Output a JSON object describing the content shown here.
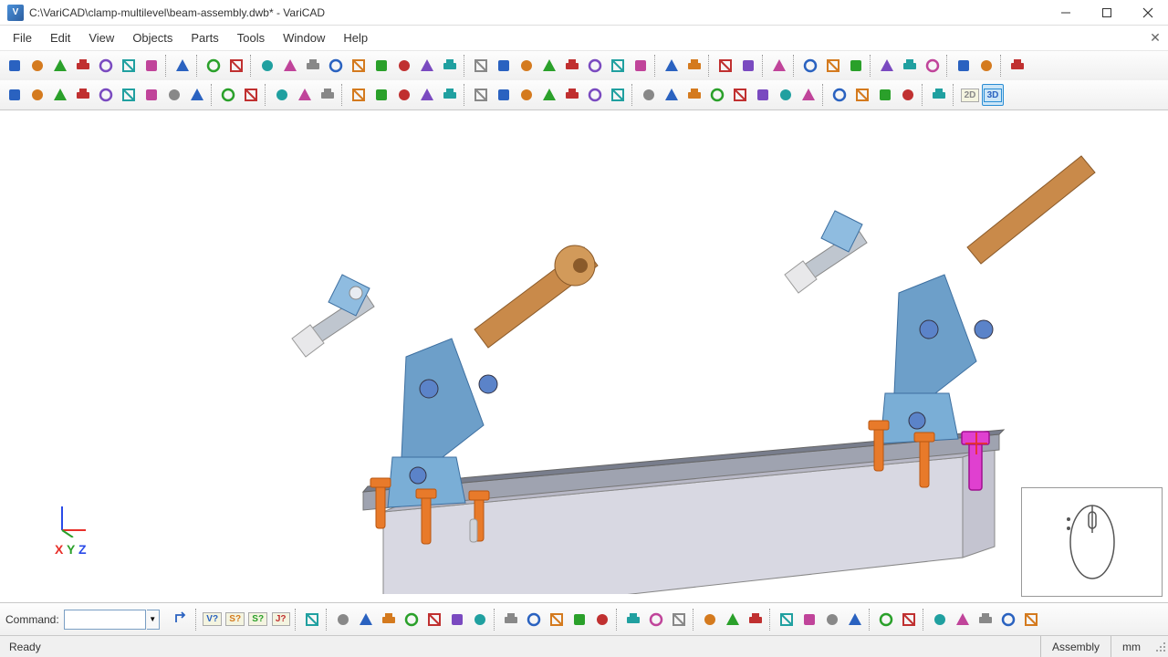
{
  "window": {
    "title": "C:\\VariCAD\\clamp-multilevel\\beam-assembly.dwb* - VariCAD",
    "app_badge": "V"
  },
  "menu": {
    "items": [
      "File",
      "Edit",
      "View",
      "Objects",
      "Parts",
      "Tools",
      "Window",
      "Help"
    ]
  },
  "toolbar1": [
    {
      "name": "new-file-icon",
      "i": true
    },
    {
      "name": "open-file-icon",
      "i": true
    },
    {
      "name": "open-folder-icon",
      "i": true
    },
    {
      "name": "export-icon",
      "i": true
    },
    {
      "name": "save-icon",
      "i": true
    },
    {
      "name": "save-all-icon",
      "i": true
    },
    {
      "name": "check-file-icon",
      "i": true
    },
    {
      "sep": true
    },
    {
      "name": "print-icon",
      "i": true
    },
    {
      "sep": true
    },
    {
      "name": "copy-icon",
      "i": true
    },
    {
      "name": "paste-icon",
      "i": true
    },
    {
      "sep": true
    },
    {
      "name": "box-solid-icon",
      "i": true
    },
    {
      "name": "sphere-icon",
      "i": true
    },
    {
      "name": "cone-icon",
      "i": true
    },
    {
      "name": "frustum-icon",
      "i": true
    },
    {
      "name": "cylinder-icon",
      "i": true
    },
    {
      "name": "pyramid-icon",
      "i": true
    },
    {
      "name": "prism-icon",
      "i": true
    },
    {
      "name": "torus-icon",
      "i": true
    },
    {
      "name": "pipe-icon",
      "i": true
    },
    {
      "sep": true
    },
    {
      "name": "extrude-icon",
      "i": true
    },
    {
      "name": "revolve-icon",
      "i": true
    },
    {
      "name": "sweep-icon",
      "i": true
    },
    {
      "name": "loft-icon",
      "i": true
    },
    {
      "name": "shell-icon",
      "i": true
    },
    {
      "name": "fillet-icon",
      "i": true
    },
    {
      "name": "chamfer-icon",
      "i": true
    },
    {
      "name": "offset-icon",
      "i": true
    },
    {
      "sep": true
    },
    {
      "name": "boolean-add-icon",
      "i": true
    },
    {
      "name": "boolean-sub-icon",
      "i": true
    },
    {
      "sep": true
    },
    {
      "name": "pattern-icon",
      "i": true
    },
    {
      "name": "mirror-icon",
      "i": true
    },
    {
      "sep": true
    },
    {
      "name": "layer-dropdown-icon",
      "i": true
    },
    {
      "sep": true
    },
    {
      "name": "zoom-window-icon",
      "i": true
    },
    {
      "name": "zoom-fit-icon",
      "i": true
    },
    {
      "name": "view-cube-icon",
      "i": true
    },
    {
      "sep": true
    },
    {
      "name": "axes-icon",
      "i": true
    },
    {
      "name": "move-3d-icon",
      "i": true
    },
    {
      "name": "rotate-3d-icon",
      "i": true
    },
    {
      "sep": true
    },
    {
      "name": "assembly-tree-icon",
      "i": true
    },
    {
      "name": "constraints-icon",
      "i": true
    },
    {
      "sep": true
    },
    {
      "name": "update-icon",
      "i": true
    }
  ],
  "toolbar2": [
    {
      "name": "dimension-icon",
      "i": true
    },
    {
      "name": "delete-icon",
      "i": true
    },
    {
      "name": "anchor-icon",
      "i": true
    },
    {
      "name": "move-up-icon",
      "i": true
    },
    {
      "name": "distribute-icon",
      "i": true
    },
    {
      "name": "rename-icon",
      "i": true
    },
    {
      "name": "pin-icon",
      "i": true
    },
    {
      "name": "anchor-set-icon",
      "i": true
    },
    {
      "name": "measure-icon",
      "i": true
    },
    {
      "sep": true
    },
    {
      "name": "wireframe-icon",
      "i": true
    },
    {
      "name": "shaded-icon",
      "i": true
    },
    {
      "sep": true
    },
    {
      "name": "material-sphere-icon",
      "i": true
    },
    {
      "name": "material-box-icon",
      "i": true
    },
    {
      "name": "material-cyl-icon",
      "i": true
    },
    {
      "sep": true
    },
    {
      "name": "section-icon",
      "i": true
    },
    {
      "name": "section-hatch-icon",
      "i": true
    },
    {
      "name": "section-fill-icon",
      "i": true
    },
    {
      "name": "solid-red-icon",
      "i": true
    },
    {
      "name": "solid-blue-icon",
      "i": true
    },
    {
      "sep": true
    },
    {
      "name": "layer-orange-icon",
      "i": true
    },
    {
      "name": "layer-orange2-icon",
      "i": true
    },
    {
      "name": "layer-orange3-icon",
      "i": true
    },
    {
      "name": "select-all-icon",
      "i": true
    },
    {
      "name": "deselect-icon",
      "i": true
    },
    {
      "name": "invert-sel-icon",
      "i": true
    },
    {
      "name": "window-icon",
      "i": true
    },
    {
      "sep": true
    },
    {
      "name": "help-dim-icon",
      "i": true
    },
    {
      "name": "dim-linear-icon",
      "i": true
    },
    {
      "name": "dim-align-icon",
      "i": true
    },
    {
      "name": "dim-angle-icon",
      "i": true
    },
    {
      "name": "dim-radius-icon",
      "i": true
    },
    {
      "name": "dim-diam-icon",
      "i": true
    },
    {
      "name": "dim-arc-icon",
      "i": true
    },
    {
      "name": "dim-help-icon",
      "i": true
    },
    {
      "sep": true
    },
    {
      "name": "zoom-in-circle-icon",
      "i": true
    },
    {
      "name": "zoom-out-circle-icon",
      "i": true
    },
    {
      "name": "arrow-left-circle-icon",
      "i": true
    },
    {
      "name": "arrow-right-circle-icon",
      "i": true
    },
    {
      "sep": true
    },
    {
      "name": "center-mass-icon",
      "i": true
    },
    {
      "sep": true
    },
    {
      "name": "mode-2d-icon",
      "i": true,
      "label": "2D"
    },
    {
      "name": "mode-3d-icon",
      "i": true,
      "label": "3D",
      "active": true
    }
  ],
  "toolbar3": [
    {
      "name": "info-v-icon",
      "i": true,
      "label": "V?"
    },
    {
      "name": "info-s-icon",
      "i": true,
      "label": "S?"
    },
    {
      "name": "info-s2-icon",
      "i": true,
      "label": "S?"
    },
    {
      "name": "info-j-icon",
      "i": true,
      "label": "J?"
    },
    {
      "sep": true
    },
    {
      "name": "edit-pencil-icon",
      "i": true
    },
    {
      "sep": true
    },
    {
      "name": "part-box-icon",
      "i": true
    },
    {
      "name": "part-cyl-icon",
      "i": true
    },
    {
      "name": "part-hook-icon",
      "i": true
    },
    {
      "name": "part-text-icon",
      "i": true
    },
    {
      "name": "part-thread-icon",
      "i": true
    },
    {
      "name": "part-gear-icon",
      "i": true
    },
    {
      "name": "part-spring-icon",
      "i": true
    },
    {
      "sep": true
    },
    {
      "name": "list-icon",
      "i": true
    },
    {
      "name": "list-add-icon",
      "i": true
    },
    {
      "name": "list-remove-icon",
      "i": true
    },
    {
      "name": "list-import-icon",
      "i": true
    },
    {
      "name": "drop-icon",
      "i": true
    },
    {
      "sep": true
    },
    {
      "name": "tree-red-icon",
      "i": true
    },
    {
      "name": "tree-red2-icon",
      "i": true
    },
    {
      "name": "tree-red3-icon",
      "i": true
    },
    {
      "sep": true
    },
    {
      "name": "group-icon",
      "i": true
    },
    {
      "name": "ungroup-icon",
      "i": true
    },
    {
      "name": "cycle-icon",
      "i": true
    },
    {
      "sep": true
    },
    {
      "name": "align-left-icon",
      "i": true
    },
    {
      "name": "align-center-icon",
      "i": true
    },
    {
      "name": "align-right-icon",
      "i": true
    },
    {
      "name": "align-del-icon",
      "i": true
    },
    {
      "sep": true
    },
    {
      "name": "highlight-yellow-icon",
      "i": true
    },
    {
      "name": "highlight-yellow2-icon",
      "i": true
    },
    {
      "sep": true
    },
    {
      "name": "check-green-icon",
      "i": true
    },
    {
      "name": "cancel-red-icon",
      "i": true
    },
    {
      "name": "cancel-red2-icon",
      "i": true
    },
    {
      "name": "cancel-orange-icon",
      "i": true
    },
    {
      "name": "cancel-red3-icon",
      "i": true
    }
  ],
  "command": {
    "label": "Command:",
    "value": "",
    "placeholder": ""
  },
  "axes": {
    "x": "X",
    "y": "Y",
    "z": "Z"
  },
  "viewport": {
    "model": "beam-assembly",
    "selected_part": "bolt (highlighted magenta)"
  },
  "status": {
    "ready": "Ready",
    "mode": "Assembly",
    "units": "mm"
  },
  "colors": {
    "steel_blue": "#6d9fc9",
    "handle_tan": "#c98a4a",
    "bolt_orange": "#e87a2a",
    "highlight_magenta": "#e040d0",
    "beam_grey": "#d8d8e2"
  }
}
